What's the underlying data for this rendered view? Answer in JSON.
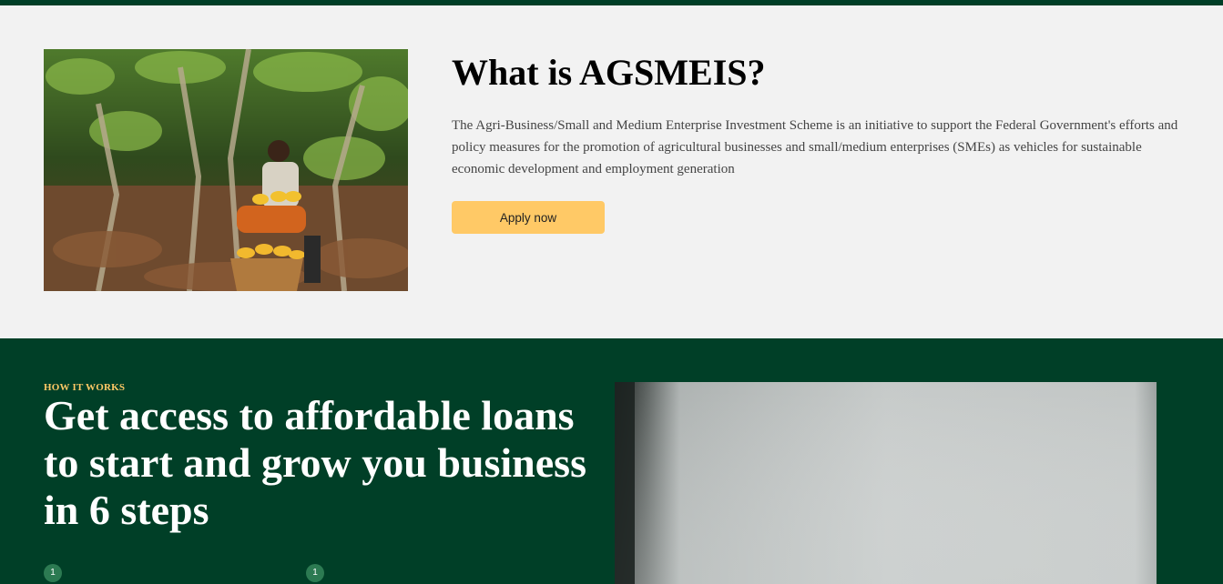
{
  "about": {
    "title": "What is AGSMEIS?",
    "description": "The Agri-Business/Small and Medium Enterprise Investment Scheme is an initiative to support the Federal Government's efforts and policy measures for the promotion of agricultural businesses and small/medium enterprises (SMEs) as vehicles for sustainable economic development and employment generation",
    "apply_label": "Apply now"
  },
  "how_it_works": {
    "eyebrow": "HOW IT WORKS",
    "title": "Get access to affordable loans to start and grow you business in 6 steps",
    "steps": [
      {
        "number": "1"
      },
      {
        "number": "1"
      }
    ]
  },
  "colors": {
    "brand_green": "#003f27",
    "accent_yellow": "#ffc966",
    "badge_green": "#2c7a52",
    "background": "#f2f2f2"
  }
}
